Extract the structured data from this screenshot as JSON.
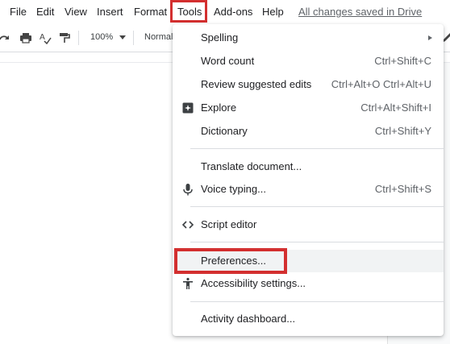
{
  "menubar": {
    "items": [
      "File",
      "Edit",
      "View",
      "Insert",
      "Format",
      "Tools",
      "Add-ons",
      "Help"
    ],
    "save_status": "All changes saved in Drive"
  },
  "toolbar": {
    "zoom": "100%",
    "style": "Normal"
  },
  "tools_menu": {
    "items": [
      {
        "label": "Spelling",
        "shortcut": "",
        "icon": "",
        "submenu": true
      },
      {
        "label": "Word count",
        "shortcut": "Ctrl+Shift+C",
        "icon": ""
      },
      {
        "label": "Review suggested edits",
        "shortcut": "Ctrl+Alt+O Ctrl+Alt+U",
        "icon": ""
      },
      {
        "label": "Explore",
        "shortcut": "Ctrl+Alt+Shift+I",
        "icon": "explore-icon"
      },
      {
        "label": "Dictionary",
        "shortcut": "Ctrl+Shift+Y",
        "icon": ""
      },
      {
        "label": "Translate document...",
        "shortcut": "",
        "icon": ""
      },
      {
        "label": "Voice typing...",
        "shortcut": "Ctrl+Shift+S",
        "icon": "microphone-icon"
      },
      {
        "label": "Script editor",
        "shortcut": "",
        "icon": "code-icon"
      },
      {
        "label": "Preferences...",
        "shortcut": "",
        "icon": ""
      },
      {
        "label": "Accessibility settings...",
        "shortcut": "",
        "icon": "accessibility-icon"
      },
      {
        "label": "Activity dashboard...",
        "shortcut": "",
        "icon": ""
      }
    ]
  },
  "colors": {
    "highlight_box": "#d32f2f",
    "hover_bg": "#f1f3f4"
  }
}
